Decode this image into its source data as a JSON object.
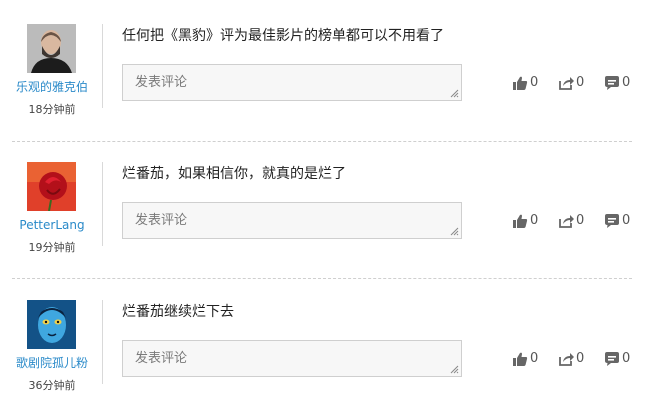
{
  "comments": [
    {
      "username": "乐观的雅克伯",
      "time": "18分钟前",
      "text": "任何把《黑豹》评为最佳影片的榜单都可以不用看了",
      "reply_placeholder": "发表评论",
      "likes": "0",
      "shares": "0",
      "replies": "0",
      "avatar": "man-beard-photo"
    },
    {
      "username": "PetterLang",
      "time": "19分钟前",
      "text": "烂番茄，如果相信你，就真的是烂了",
      "reply_placeholder": "发表评论",
      "likes": "0",
      "shares": "0",
      "replies": "0",
      "avatar": "red-rose-photo"
    },
    {
      "username": "歌剧院孤儿粉",
      "time": "36分钟前",
      "text": "烂番茄继续烂下去",
      "reply_placeholder": "发表评论",
      "likes": "0",
      "shares": "0",
      "replies": "0",
      "avatar": "blue-face-photo"
    }
  ],
  "colors": {
    "username": "#2a8ac9",
    "text": "#222222",
    "icon": "#666666",
    "divider": "#cfcfcf"
  }
}
